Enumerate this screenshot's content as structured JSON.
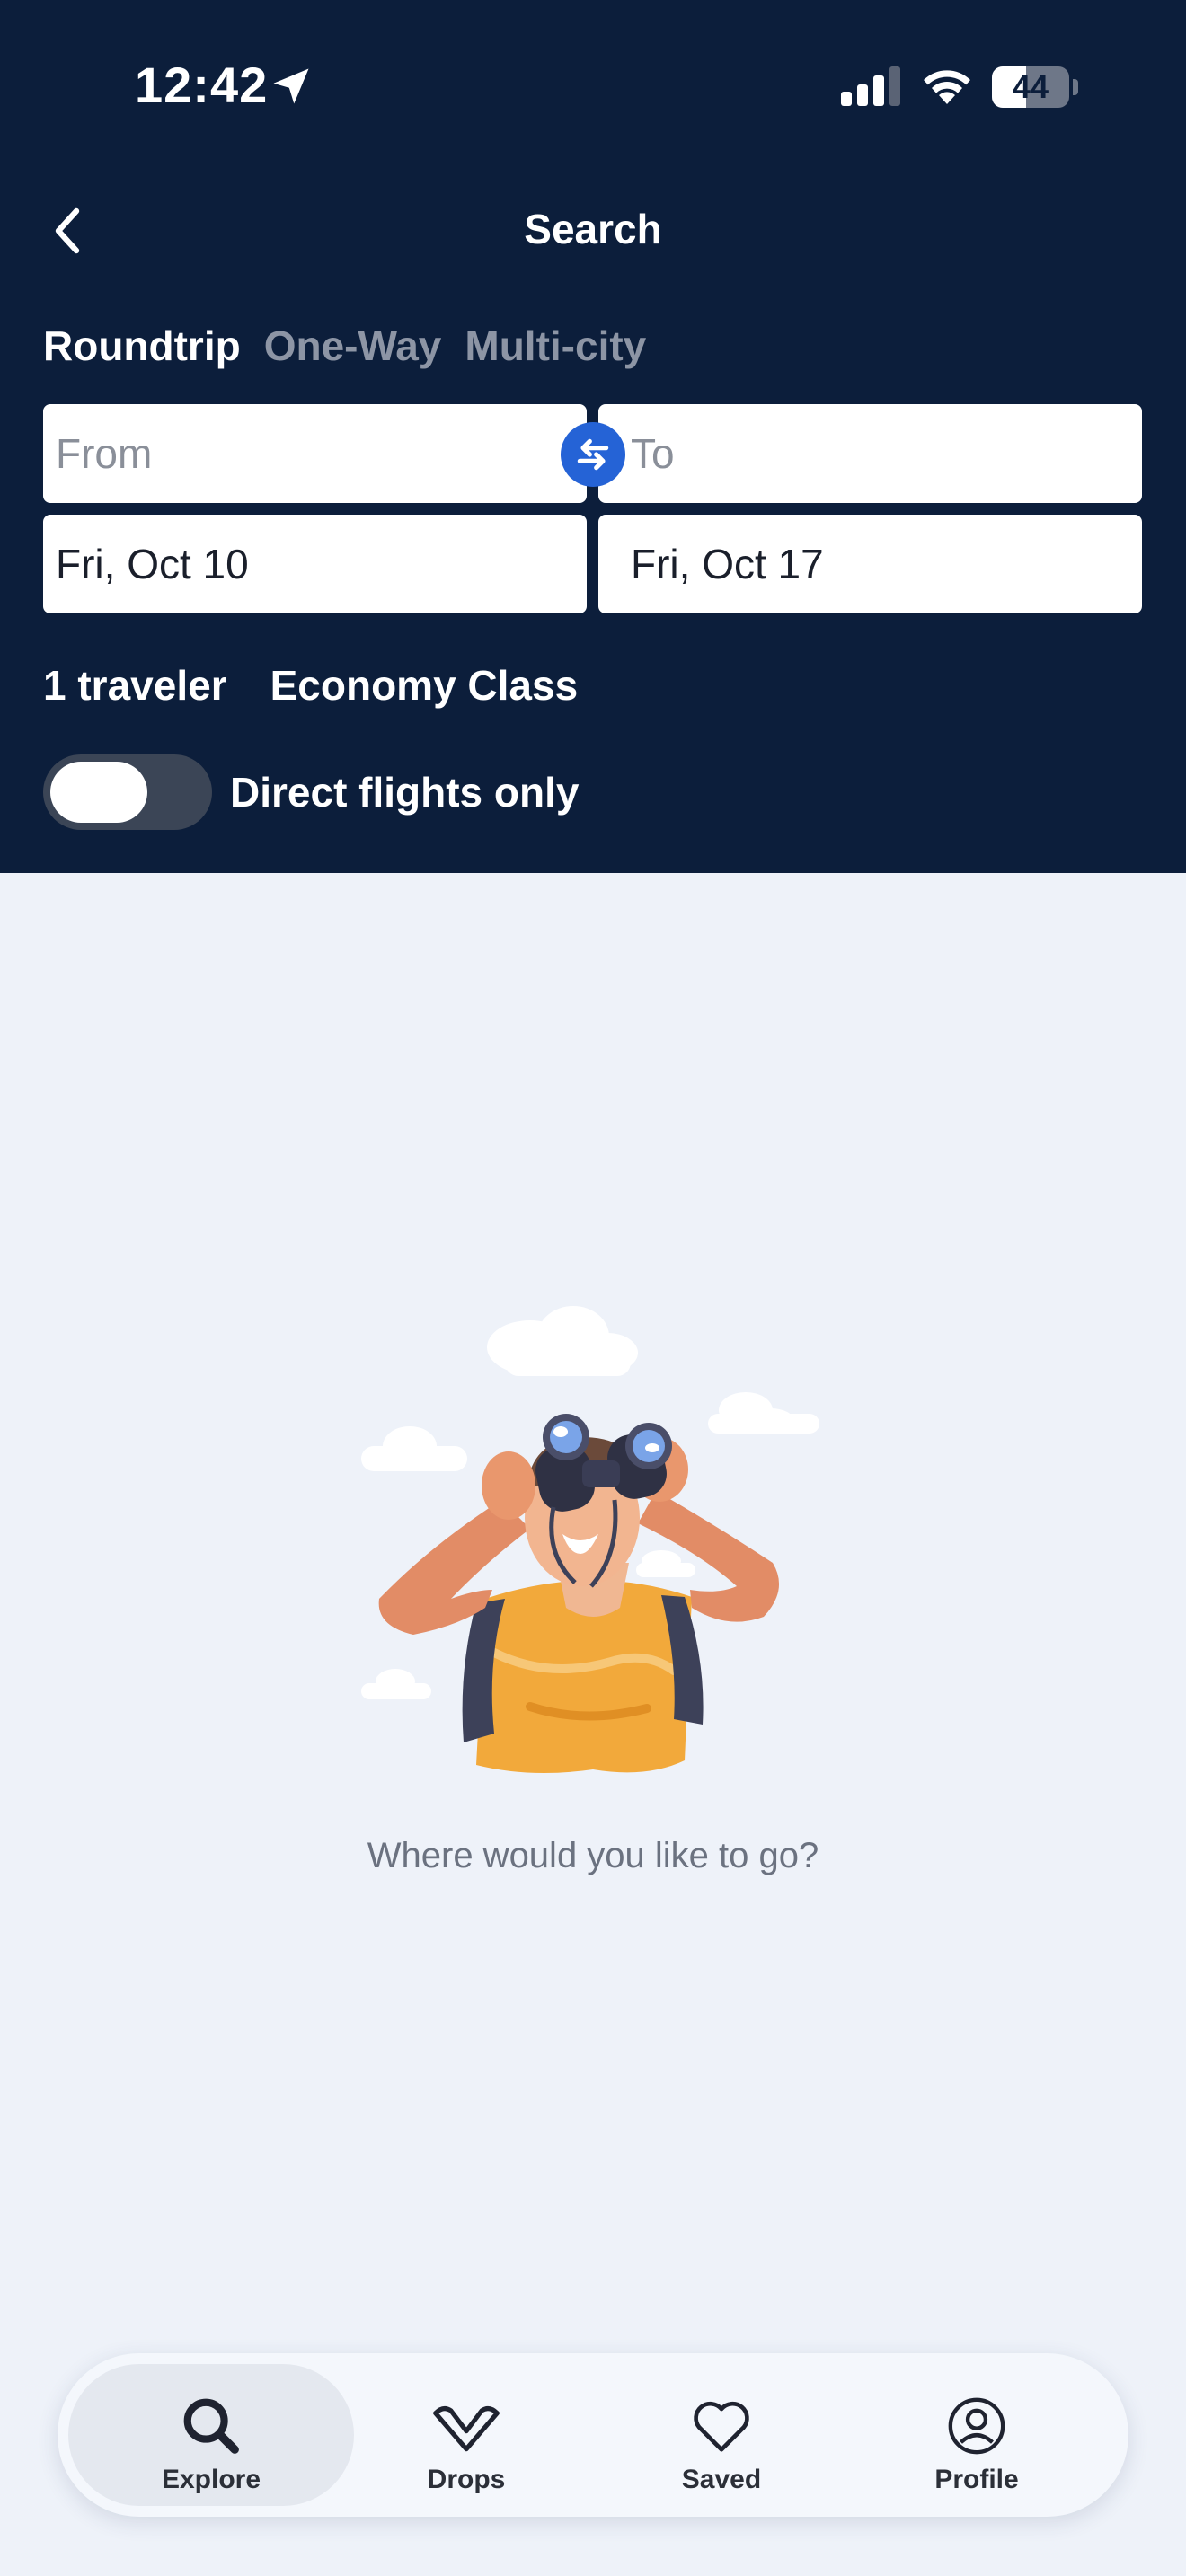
{
  "status_bar": {
    "time": "12:42",
    "battery": "44",
    "battery_level": 0.44
  },
  "nav": {
    "title": "Search"
  },
  "trip_types": [
    {
      "label": "Roundtrip",
      "active": true
    },
    {
      "label": "One-Way",
      "active": false
    },
    {
      "label": "Multi-city",
      "active": false
    }
  ],
  "search": {
    "from_placeholder": "From",
    "to_placeholder": "To",
    "depart_date": "Fri, Oct 10",
    "return_date": "Fri, Oct 17",
    "travelers": "1 traveler",
    "cabin_class": "Economy Class",
    "direct_flights_label": "Direct flights only",
    "direct_flights_enabled": false
  },
  "empty_state": {
    "message": "Where would you like to go?"
  },
  "tabbar": {
    "items": [
      {
        "label": "Explore",
        "icon": "search-icon",
        "active": true
      },
      {
        "label": "Drops",
        "icon": "chevron-heart-icon",
        "active": false
      },
      {
        "label": "Saved",
        "icon": "heart-icon",
        "active": false
      },
      {
        "label": "Profile",
        "icon": "profile-icon",
        "active": false
      }
    ]
  },
  "colors": {
    "header_bg": "#0c1e3b",
    "page_bg": "#eef2f9",
    "accent": "#2563d6",
    "muted_tab": "#8d95a5"
  }
}
